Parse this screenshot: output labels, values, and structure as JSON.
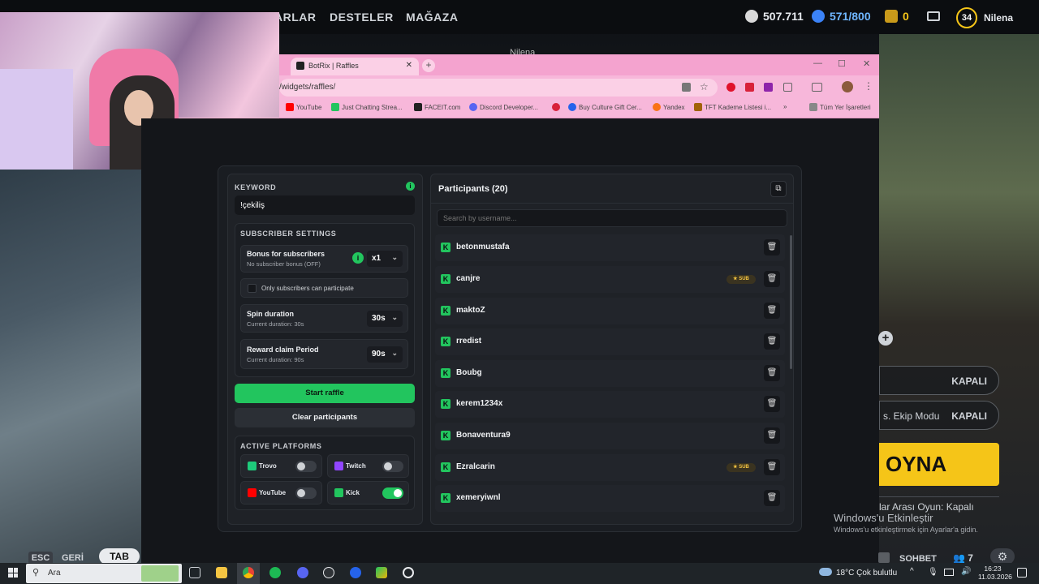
{
  "topbar": {
    "nav": [
      "ARLAR",
      "DESTELER",
      "MAĞAZA"
    ],
    "currency": "507.711",
    "energy": "571/800",
    "tokens": "0",
    "level": "34",
    "player": "Nilena",
    "sub_player": "Nilena"
  },
  "browser": {
    "tab_title": "BotRix | Raffles",
    "address": "/widgets/raffles/",
    "bookmarks": [
      "YouTube",
      "Just Chatting Strea...",
      "FACEIT.com",
      "Discord Developer...",
      "Buy Culture Gift Cer...",
      "Yandex",
      "TFT Kademe Listesi i..."
    ],
    "bookmarks_more": "»",
    "all_bookmarks": "Tüm Yer İşaretleri"
  },
  "raffle": {
    "keyword_label": "KEYWORD",
    "keyword_value": "!çekiliş",
    "subscriber_settings_label": "SUBSCRIBER SETTINGS",
    "bonus_title": "Bonus for subscribers",
    "bonus_sub": "No subscriber bonus (OFF)",
    "bonus_value": "x1",
    "only_subs_label": "Only subscribers can participate",
    "spin_title": "Spin duration",
    "spin_sub": "Current duration: 30s",
    "spin_value": "30s",
    "claim_title": "Reward claim Period",
    "claim_sub": "Current duration: 90s",
    "claim_value": "90s",
    "start_label": "Start raffle",
    "clear_label": "Clear participants",
    "platforms_label": "ACTIVE PLATFORMS",
    "platforms": [
      {
        "name": "Trovo",
        "on": false,
        "color": "#1ecb7b"
      },
      {
        "name": "Twitch",
        "on": false,
        "color": "#9146ff"
      },
      {
        "name": "YouTube",
        "on": false,
        "color": "#ff0000"
      },
      {
        "name": "Kick",
        "on": true,
        "color": "#22c55e"
      }
    ]
  },
  "participants": {
    "title": "Participants (20)",
    "search_placeholder": "Search by username...",
    "sub_badge": "SUB",
    "list": [
      {
        "name": "betonmustafa",
        "sub": false
      },
      {
        "name": "canjre",
        "sub": true
      },
      {
        "name": "maktoZ",
        "sub": false
      },
      {
        "name": "rredist",
        "sub": false
      },
      {
        "name": "Boubg",
        "sub": false
      },
      {
        "name": "kerem1234x",
        "sub": false
      },
      {
        "name": "Bonaventura9",
        "sub": false
      },
      {
        "name": "Ezralcarin",
        "sub": true
      },
      {
        "name": "xemeryiwnl",
        "sub": false
      }
    ]
  },
  "game": {
    "kapali_1": "KAPALI",
    "ekip_label": "s. Ekip Modu",
    "kapali_2": "KAPALI",
    "play_label": "OYNA",
    "arasi_label": "lar Arası Oyun: Kapalı",
    "activate_title": "Windows'u Etkinleştir",
    "activate_sub": "Windows'u etkinleştirmek için Ayarlar'a gidin.",
    "esc_label": "ESC",
    "back_label": "GERİ",
    "tab_label": "TAB",
    "chat_label": "SOHBET",
    "friends_count": "7"
  },
  "taskbar": {
    "search_placeholder": "Ara",
    "weather": "18°C  Çok bulutlu",
    "time": "16:23",
    "date": "11.03.2026"
  },
  "colors": {
    "accent": "#22c55e",
    "panel": "#1f2227",
    "browser_pink": "#f4a3cf",
    "play_yellow": "#f5c518"
  }
}
